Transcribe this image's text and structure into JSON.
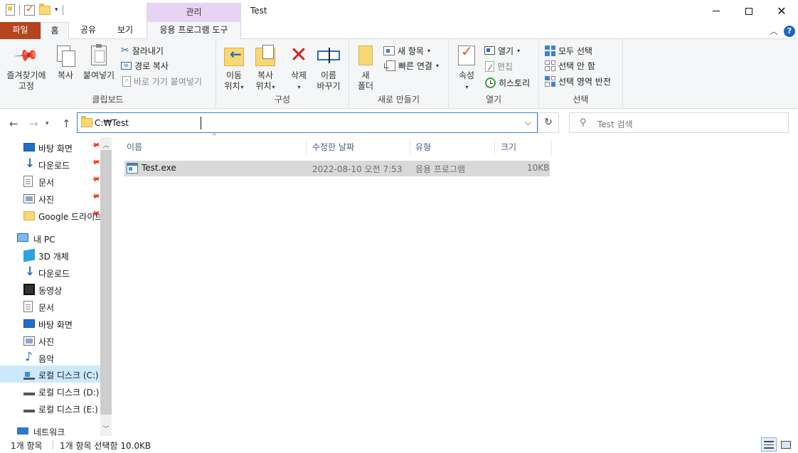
{
  "window": {
    "title": "Test",
    "context_tab_label": "관리"
  },
  "ribbon_tabs": {
    "file": "파일",
    "home": "홈",
    "share": "공유",
    "view": "보기",
    "app_tools": "응용 프로그램 도구"
  },
  "clipboard": {
    "pin": [
      "즐겨찾기에",
      "고정"
    ],
    "copy": "복사",
    "paste": "붙여넣기",
    "cut": "잘라내기",
    "copy_path": "경로 복사",
    "paste_shortcut": "바로 가기 붙여넣기",
    "group_label": "클립보드"
  },
  "organize": {
    "move_to": [
      "이동",
      "위치"
    ],
    "copy_to": [
      "복사",
      "위치"
    ],
    "delete": "삭제",
    "rename": [
      "이름",
      "바꾸기"
    ],
    "group_label": "구성"
  },
  "new": {
    "new_folder": [
      "새",
      "폴더"
    ],
    "new_item": "새 항목",
    "easy_access": "빠른 연결",
    "group_label": "새로 만들기"
  },
  "open": {
    "properties": "속성",
    "open": "열기",
    "edit": "편집",
    "history": "히스토리",
    "group_label": "열기"
  },
  "select": {
    "select_all": "모두 선택",
    "select_none": "선택 안 함",
    "invert": "선택 영역 반전",
    "group_label": "선택"
  },
  "address": {
    "path": "C:₩Test",
    "search_placeholder": "Test 검색"
  },
  "nav_pane": {
    "quick_access": [
      {
        "label": "바탕 화면",
        "icon": "desktop-icon",
        "pinned": true
      },
      {
        "label": "다운로드",
        "icon": "download-icon",
        "pinned": true
      },
      {
        "label": "문서",
        "icon": "document-icon",
        "pinned": true
      },
      {
        "label": "사진",
        "icon": "pictures-icon",
        "pinned": true
      },
      {
        "label": "Google 드라이브",
        "icon": "folder-icon",
        "pinned": true
      }
    ],
    "this_pc": "내 PC",
    "pc_items": [
      {
        "label": "3D 개체",
        "icon": "3d-objects-icon"
      },
      {
        "label": "다운로드",
        "icon": "download-icon"
      },
      {
        "label": "동영상",
        "icon": "video-icon"
      },
      {
        "label": "문서",
        "icon": "document-icon"
      },
      {
        "label": "바탕 화면",
        "icon": "desktop-icon"
      },
      {
        "label": "사진",
        "icon": "pictures-icon"
      },
      {
        "label": "음악",
        "icon": "music-icon"
      },
      {
        "label": "로컬 디스크 (C:)",
        "icon": "windows-drive-icon",
        "selected": true
      },
      {
        "label": "로컬 디스크 (D:)",
        "icon": "drive-icon"
      },
      {
        "label": "로컬 디스크 (E:)",
        "icon": "drive-icon"
      }
    ],
    "network": "네트워크"
  },
  "file_list": {
    "columns": {
      "name": "이름",
      "modified": "수정한 날짜",
      "type": "유형",
      "size": "크기"
    },
    "rows": [
      {
        "name": "Test.exe",
        "modified": "2022-08-10 오전 7:53",
        "type": "응용 프로그램",
        "size": "10KB",
        "selected": true
      }
    ]
  },
  "status": {
    "item_count": "1개 항목",
    "selection": "1개 항목 선택함 10.0KB"
  },
  "colors": {
    "file_tab": "#b5441f",
    "context_tab": "#e8d3f4",
    "selection": "#cce8ff",
    "row_selected": "#d9d9d9",
    "address_focus": "#3a84cf"
  }
}
